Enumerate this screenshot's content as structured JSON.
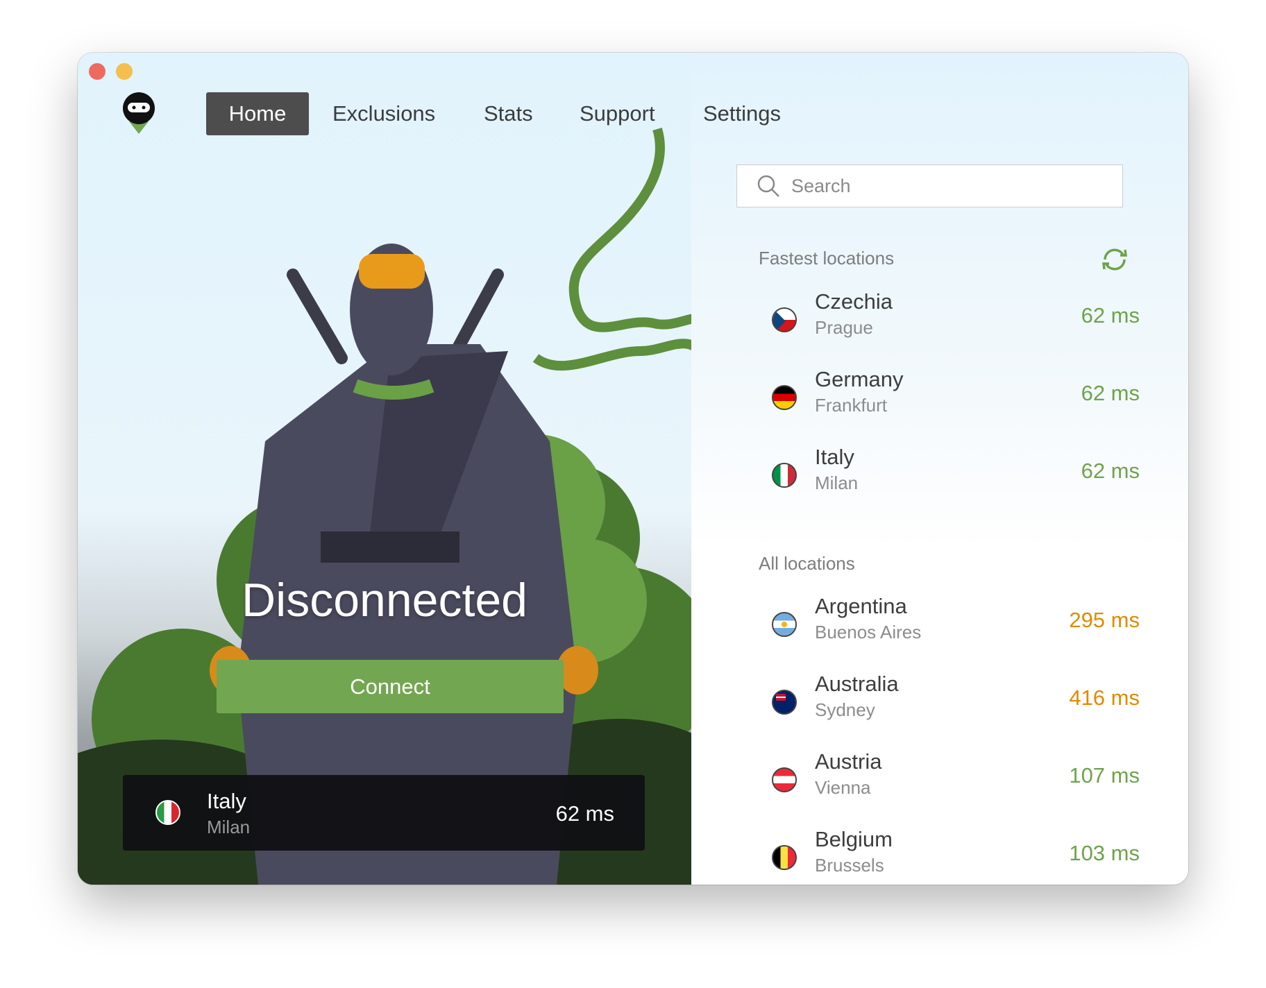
{
  "window": {
    "controls": [
      "close",
      "minimize"
    ]
  },
  "nav": {
    "tabs": [
      {
        "label": "Home",
        "active": true
      },
      {
        "label": "Exclusions"
      },
      {
        "label": "Stats"
      },
      {
        "label": "Support"
      },
      {
        "label": "Settings"
      }
    ]
  },
  "status": {
    "text": "Disconnected",
    "connect_label": "Connect"
  },
  "selected": {
    "country": "Italy",
    "city": "Milan",
    "latency": "62 ms"
  },
  "search": {
    "placeholder": "Search"
  },
  "fastest": {
    "label": "Fastest locations",
    "items": [
      {
        "country": "Czechia",
        "city": "Prague",
        "latency": "62 ms"
      },
      {
        "country": "Germany",
        "city": "Frankfurt",
        "latency": "62 ms"
      },
      {
        "country": "Italy",
        "city": "Milan",
        "latency": "62 ms"
      }
    ]
  },
  "all": {
    "label": "All locations",
    "items": [
      {
        "country": "Argentina",
        "city": "Buenos Aires",
        "latency": "295 ms"
      },
      {
        "country": "Australia",
        "city": "Sydney",
        "latency": "416 ms"
      },
      {
        "country": "Austria",
        "city": "Vienna",
        "latency": "107 ms"
      },
      {
        "country": "Belgium",
        "city": "Brussels",
        "latency": "103 ms"
      }
    ]
  },
  "colors": {
    "good": "#6ea34a",
    "slow": "#e08a00",
    "accent": "#73a651",
    "tab_active": "#4d4d4d"
  }
}
